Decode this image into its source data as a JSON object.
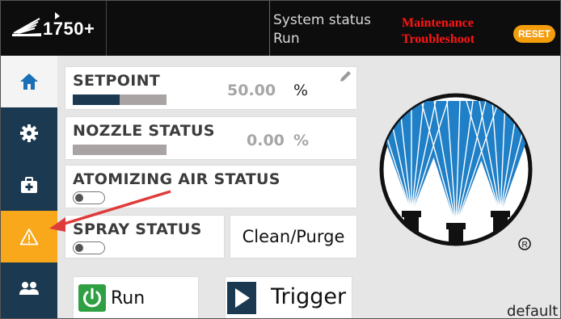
{
  "header": {
    "model": "1750+",
    "status_label": "System status",
    "status_value": "Run",
    "alarm_line1": "Maintenance",
    "alarm_line2": "Troubleshoot",
    "reset_label": "RESET"
  },
  "sidebar": {
    "items": [
      {
        "icon": "home-icon",
        "state": "active"
      },
      {
        "icon": "gear-icon",
        "state": "normal"
      },
      {
        "icon": "toolbox-icon",
        "state": "normal"
      },
      {
        "icon": "warning-icon",
        "state": "alarm"
      },
      {
        "icon": "users-icon",
        "state": "normal"
      }
    ]
  },
  "cards": {
    "setpoint": {
      "title": "SETPOINT",
      "value": "50.00",
      "unit": "%",
      "fill_fraction": 0.5
    },
    "nozzle_status": {
      "title": "NOZZLE STATUS",
      "value": "0.00",
      "unit": "%",
      "fill_fraction": 0.0
    },
    "atomizing_air": {
      "title": "ATOMIZING AIR STATUS",
      "toggle": "off"
    },
    "spray_status": {
      "title": "SPRAY STATUS",
      "toggle": "off"
    }
  },
  "buttons": {
    "clean_purge": "Clean/Purge",
    "run": "Run",
    "trigger": "Trigger"
  },
  "footer": {
    "default_label": "default"
  },
  "colors": {
    "header_bg": "#0d0d0d",
    "sidebar_bg": "#1b3a52",
    "alarm_orange": "#f8a81a",
    "alarm_text": "#ff1414",
    "run_green": "#2ea043",
    "brand_blue": "#1f7fc7"
  }
}
